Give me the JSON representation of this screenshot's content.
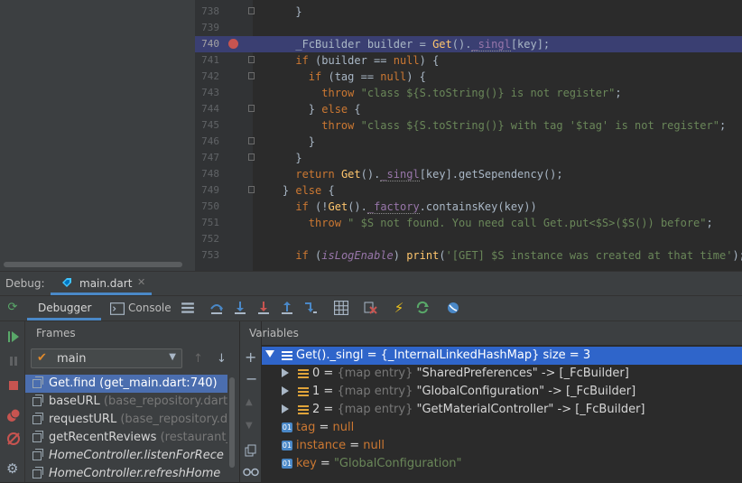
{
  "editor": {
    "lines": [
      {
        "num": "738",
        "code": "      }",
        "fold": true
      },
      {
        "num": "739",
        "code": ""
      },
      {
        "num": "740",
        "code": "      _FcBuilder builder = Get()._singl[key];",
        "breakpoint": true,
        "highlight": true
      },
      {
        "num": "741",
        "code": "      if (builder == null) {",
        "fold": true
      },
      {
        "num": "742",
        "code": "        if (tag == null) {",
        "fold": true
      },
      {
        "num": "743",
        "code": "          throw \"class ${S.toString()} is not register\";"
      },
      {
        "num": "744",
        "code": "        } else {",
        "fold": true
      },
      {
        "num": "745",
        "code": "          throw \"class ${S.toString()} with tag '$tag' is not register\";"
      },
      {
        "num": "746",
        "code": "        }",
        "fold": true
      },
      {
        "num": "747",
        "code": "      }",
        "fold": true
      },
      {
        "num": "748",
        "code": "      return Get()._singl[key].getSependency();"
      },
      {
        "num": "749",
        "code": "    } else {",
        "fold": true
      },
      {
        "num": "750",
        "code": "      if (!Get()._factory.containsKey(key))"
      },
      {
        "num": "751",
        "code": "        throw \" $S not found. You need call Get.put<$S>($S()) before\";"
      },
      {
        "num": "752",
        "code": ""
      },
      {
        "num": "753",
        "code": "      if (isLogEnable) print('[GET] $S instance was created at that time');"
      }
    ]
  },
  "debug_header": {
    "label": "Debug:",
    "tab_label": "main.dart"
  },
  "toolbar": {
    "debugger_label": "Debugger",
    "console_label": "Console"
  },
  "frames": {
    "title": "Frames",
    "thread": "main",
    "items": [
      {
        "name": "Get.find",
        "loc": " (get_main.dart:740)",
        "selected": true
      },
      {
        "name": "baseURL",
        "loc": " (base_repository.dart"
      },
      {
        "name": "requestURL",
        "loc": " (base_repository.dar"
      },
      {
        "name": "getRecentReviews",
        "loc": " (restaurant_re"
      },
      {
        "name": "HomeController.listenForRece",
        "loc": "",
        "italic": true
      },
      {
        "name": "HomeController.refreshHome",
        "loc": "",
        "italic": true
      }
    ]
  },
  "variables": {
    "title": "Variables",
    "root": {
      "name": "Get()._singl",
      "value": " = {_InternalLinkedHashMap} size = 3"
    },
    "entries": [
      {
        "index": "0",
        "tag": "{map entry}",
        "key": "\"SharedPreferences\"",
        "value": " -> [_FcBuilder]"
      },
      {
        "index": "1",
        "tag": "{map entry}",
        "key": "\"GlobalConfiguration\"",
        "value": " -> [_FcBuilder]"
      },
      {
        "index": "2",
        "tag": "{map entry}",
        "key": "\"GetMaterialController\"",
        "value": " -> [_FcBuilder]"
      }
    ],
    "fields": [
      {
        "name": "tag",
        "eq": " = ",
        "value": "null",
        "kind": "null"
      },
      {
        "name": "instance",
        "eq": " = ",
        "value": "null",
        "kind": "null"
      },
      {
        "name": "key",
        "eq": " = ",
        "value": "\"GlobalConfiguration\"",
        "kind": "string"
      }
    ]
  },
  "colors": {
    "accent": "#4a88c7",
    "selection": "#2f65ca",
    "breakpoint": "#c75450"
  }
}
